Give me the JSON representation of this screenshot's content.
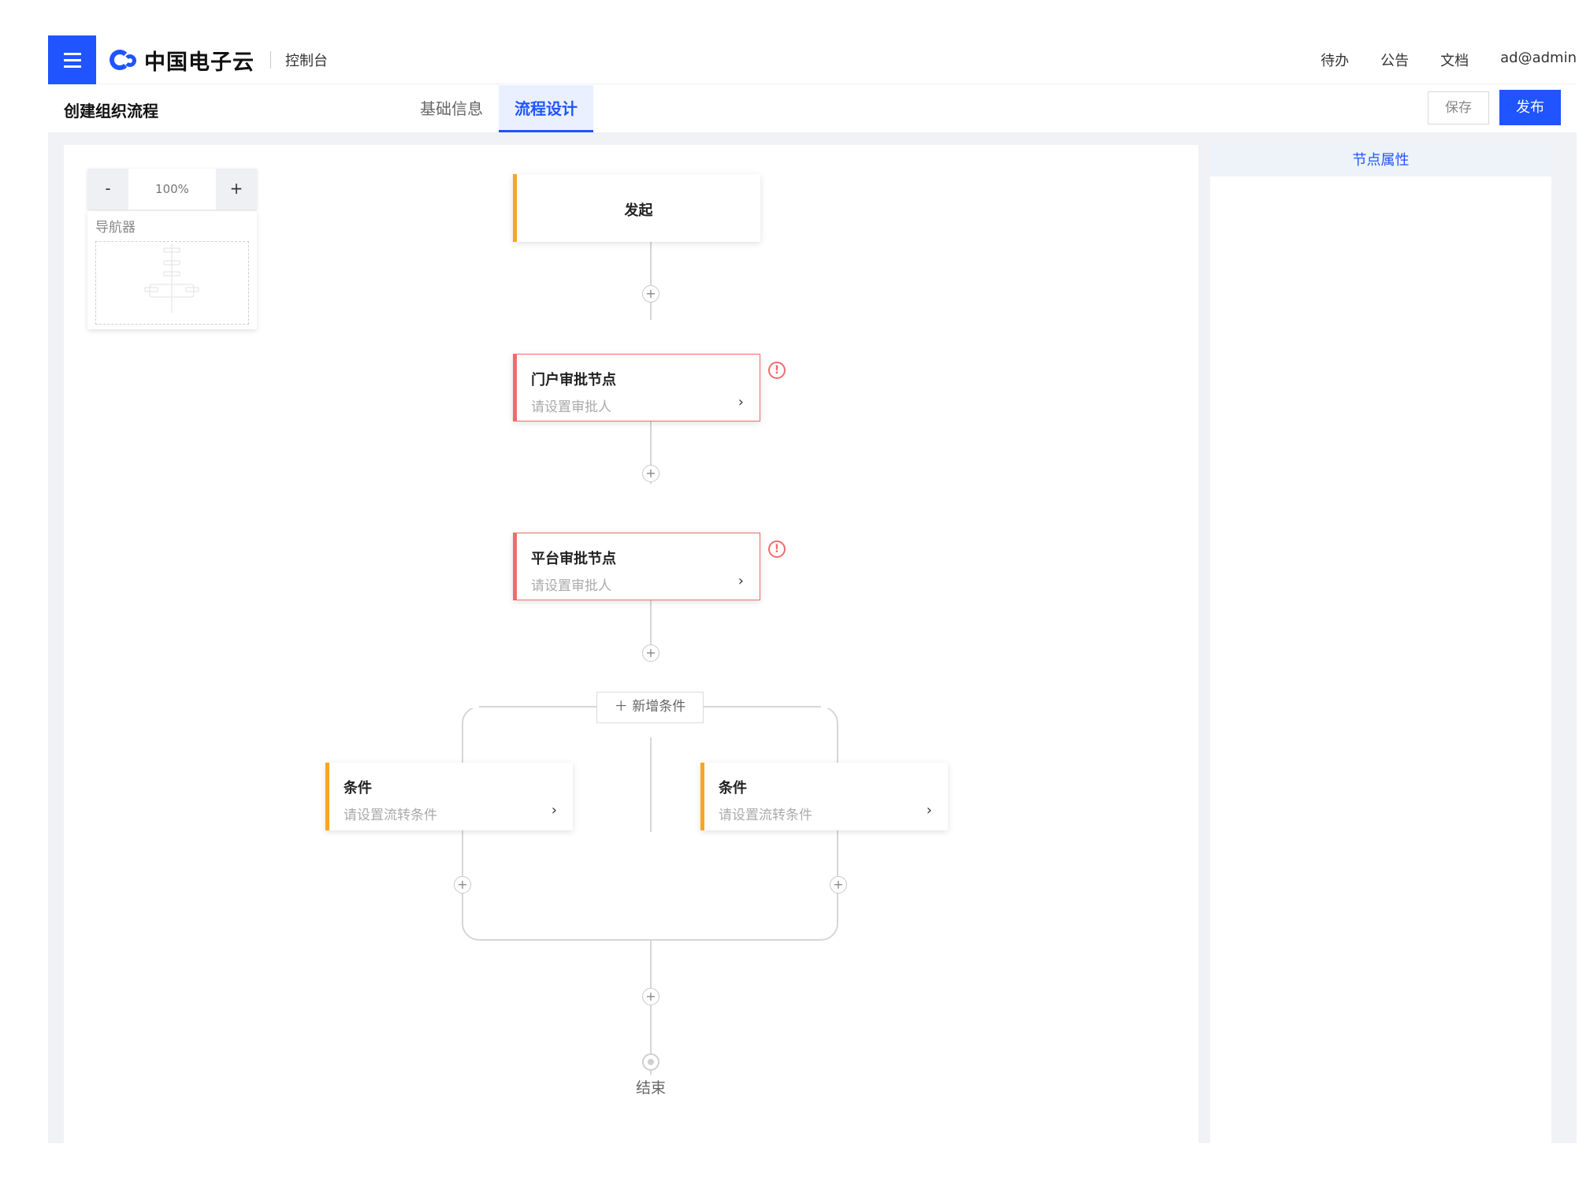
{
  "header": {
    "logo_text": "中国电子云",
    "console_label": "控制台",
    "nav": [
      "待办",
      "公告",
      "文档",
      "ad@admin"
    ]
  },
  "titlebar": {
    "page_title": "创建组织流程",
    "tabs": [
      {
        "label": "基础信息",
        "active": false
      },
      {
        "label": "流程设计",
        "active": true
      }
    ],
    "save_label": "保存",
    "publish_label": "发布"
  },
  "canvas": {
    "zoom": {
      "minus": "-",
      "value": "100%",
      "plus": "+"
    },
    "navigator_label": "导航器",
    "flow": {
      "start_label": "发起",
      "approval_nodes": [
        {
          "title": "门户审批节点",
          "subtitle": "请设置审批人",
          "warning": true
        },
        {
          "title": "平台审批节点",
          "subtitle": "请设置审批人",
          "warning": true
        }
      ],
      "add_condition_label": "＋ 新增条件",
      "conditions": [
        {
          "title": "条件",
          "subtitle": "请设置流转条件"
        },
        {
          "title": "条件",
          "subtitle": "请设置流转条件"
        }
      ],
      "end_label": "结束"
    }
  },
  "panel": {
    "title": "节点属性"
  },
  "colors": {
    "accent": "#1f54ff",
    "warning": "#f26b6b",
    "start": "#f5a623"
  }
}
